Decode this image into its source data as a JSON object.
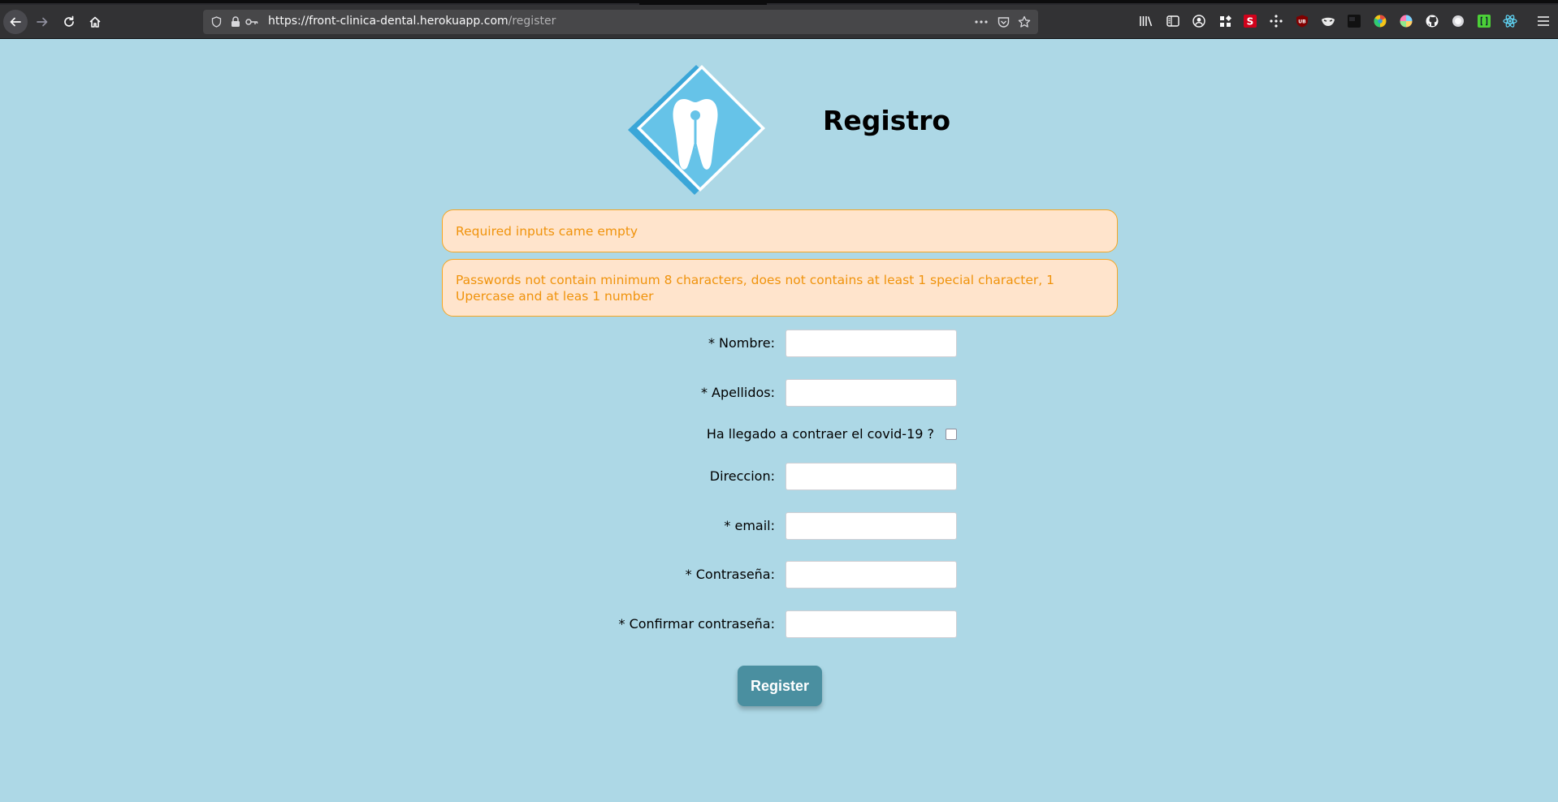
{
  "browser": {
    "url_host": "https://front-clinica-dental.herokuapp.com",
    "url_path": "/register",
    "extensions": [
      "library-icon",
      "sidebar-icon",
      "account-icon",
      "grid-icon",
      "s-extension-icon",
      "dots-extension-icon",
      "ublock-icon",
      "mask-extension-icon",
      "dark-extension-icon",
      "chrome-colored-icon",
      "color-wheel-icon",
      "github-icon",
      "circle-extension-icon",
      "bracket-extension-icon",
      "react-icon"
    ],
    "s_badge": "S",
    "ub_badge": "UB"
  },
  "page": {
    "title": "Registro",
    "alerts": [
      "Required inputs came empty",
      "Passwords not contain minimum 8 characters, does not contains at least 1 special character, 1 Upercase and at leas 1 number"
    ],
    "form": {
      "nombre_label": "* Nombre:",
      "apellidos_label": "* Apellidos:",
      "covid_label": "Ha llegado a contraer el covid-19 ?",
      "direccion_label": "Direccion:",
      "email_label": "* email:",
      "password_label": "* Contraseña:",
      "confirm_label": "* Confirmar contraseña:"
    },
    "register_button": "Register"
  },
  "colors": {
    "background": "#add8e6",
    "logo_blue": "#5bbde0",
    "alert_bg": "#ffe4cc",
    "alert_text": "#f0930c",
    "button": "#4a8fa0"
  }
}
